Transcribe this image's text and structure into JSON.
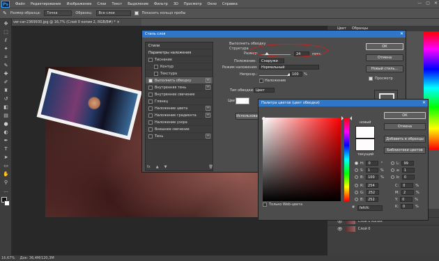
{
  "app": {
    "logo": "Ps"
  },
  "menu": [
    "Файл",
    "Редактирование",
    "Изображение",
    "Слои",
    "Текст",
    "Выделение",
    "Фильтр",
    "3D",
    "Просмотр",
    "Окно",
    "Справка"
  ],
  "window_controls": [
    "—",
    "▢",
    "✕"
  ],
  "options": {
    "size_label": "Размер образца:",
    "size_value": "Точка",
    "sample_label": "Образец:",
    "sample_value": "Все слои",
    "show_ring_label": "Показать кольцо пробы"
  },
  "document": {
    "tab_title": "ver-car-2369930.jpg @ 16,7% (Слой 0 копия 2, RGB/8#) *",
    "tab_close": "×",
    "status": "16,67%",
    "status_doc": "Док: 36,4M/120,3M"
  },
  "right_panel": {
    "tabs": [
      "Цвет",
      "Образцы"
    ]
  },
  "layers": [
    {
      "name": "Слой 0 копия"
    },
    {
      "name": "Слой 0"
    }
  ],
  "layer_style": {
    "title": "Стиль слоя",
    "close": "✕",
    "list": [
      {
        "label": "Стили",
        "checkbox": false,
        "plus": false,
        "header": true
      },
      {
        "label": "Параметры наложения",
        "checkbox": false,
        "plus": false,
        "header": true
      },
      {
        "label": "Тиснение",
        "checkbox": true,
        "plus": false
      },
      {
        "label": "Контур",
        "checkbox": true,
        "plus": false,
        "indent": true
      },
      {
        "label": "Текстура",
        "checkbox": true,
        "plus": false,
        "indent": true
      },
      {
        "label": "Выполнить обводку",
        "checkbox": true,
        "checked": true,
        "plus": true,
        "selected": true
      },
      {
        "label": "Внутренняя тень",
        "checkbox": true,
        "plus": true
      },
      {
        "label": "Внутреннее свечение",
        "checkbox": true,
        "plus": false
      },
      {
        "label": "Глянец",
        "checkbox": true,
        "plus": false
      },
      {
        "label": "Наложение цвета",
        "checkbox": true,
        "plus": true
      },
      {
        "label": "Наложение градиента",
        "checkbox": true,
        "plus": true
      },
      {
        "label": "Наложение узора",
        "checkbox": true,
        "plus": false
      },
      {
        "label": "Внешнее свечение",
        "checkbox": true,
        "plus": false
      },
      {
        "label": "Тень",
        "checkbox": true,
        "plus": true
      }
    ],
    "footer": [
      "fx",
      "▲",
      "▼",
      "🗑"
    ],
    "stroke": {
      "section_title": "Выполнить обводку",
      "structure_title": "Структура",
      "size_label": "Размер:",
      "size_value": "24",
      "size_unit": "пикс.",
      "position_label": "Положение:",
      "position_value": "Снаружи",
      "blend_label": "Режим наложения:",
      "blend_value": "Нормальный",
      "opacity_label": "Непрозр.:",
      "opacity_value": "100",
      "opacity_unit": "%",
      "overprint_label": "Наложение",
      "fill_type_label": "Тип обводки:",
      "fill_type_value": "Цвет",
      "color_label": "Цвет:",
      "default_button": "Использовать п"
    },
    "buttons": {
      "ok": "ОК",
      "cancel": "Отмена",
      "new_style": "Новый стиль...",
      "preview": "Просмотр"
    }
  },
  "color_picker": {
    "title": "Палитра цветов (цвет обводки)",
    "close": "✕",
    "new_label": "новый",
    "current_label": "текущий",
    "web_only_label": "Только Web-цвета",
    "buttons": {
      "ok": "ОК",
      "cancel": "Отмена",
      "add_swatches": "Добавить в образцы",
      "libraries": "Библиотеки цветов"
    },
    "hsb": [
      {
        "key": "H:",
        "value": "0",
        "unit": "°",
        "on": true
      },
      {
        "key": "S:",
        "value": "1",
        "unit": "%"
      },
      {
        "key": "B:",
        "value": "100",
        "unit": "%"
      }
    ],
    "rgb": [
      {
        "key": "R:",
        "value": "254"
      },
      {
        "key": "G:",
        "value": "252"
      },
      {
        "key": "B:",
        "value": "252"
      }
    ],
    "lab": [
      {
        "key": "L:",
        "value": "99"
      },
      {
        "key": "a:",
        "value": "1"
      },
      {
        "key": "b:",
        "value": "0"
      }
    ],
    "cmyk": [
      {
        "key": "C:",
        "value": "0",
        "unit": "%"
      },
      {
        "key": "M:",
        "value": "2",
        "unit": "%"
      },
      {
        "key": "Y:",
        "value": "0",
        "unit": "%"
      },
      {
        "key": "K:",
        "value": "0",
        "unit": "%"
      }
    ],
    "hex_prefix": "#",
    "hex": "fefcfc",
    "new_color": "#fefcfc",
    "current_color": "#fefcfc"
  },
  "colors": {
    "accent": "#2f76c8",
    "highlight_oval": "#d42020"
  },
  "icons": [
    "eyedropper-icon",
    "move-icon",
    "marquee-icon",
    "lasso-icon",
    "crop-icon",
    "brush-icon",
    "eraser-icon",
    "type-icon",
    "hand-icon",
    "zoom-icon",
    "eye-icon",
    "trash-icon"
  ]
}
